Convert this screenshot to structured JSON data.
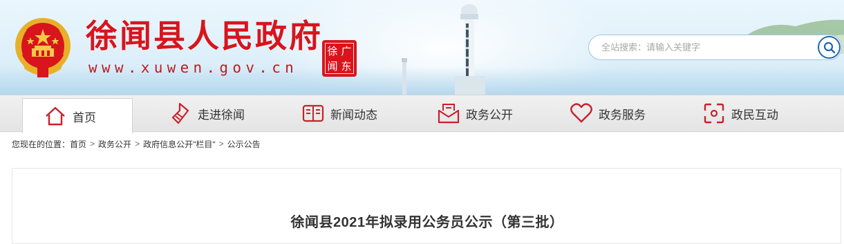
{
  "header": {
    "site_title": "徐闻县人民政府",
    "site_url": "www.xuwen.gov.cn",
    "seal_chars": [
      "徐",
      "广",
      "闻",
      "东"
    ]
  },
  "search": {
    "placeholder": "全站搜索：请输入关键字",
    "button_icon": "search-icon"
  },
  "nav": {
    "items": [
      {
        "label": "首页",
        "icon": "home-icon",
        "active": true
      },
      {
        "label": "走进徐闻",
        "icon": "lightning-tag-icon",
        "active": false
      },
      {
        "label": "新闻动态",
        "icon": "book-icon",
        "active": false
      },
      {
        "label": "政务公开",
        "icon": "mail-document-icon",
        "active": false
      },
      {
        "label": "政务服务",
        "icon": "heart-icon",
        "active": false
      },
      {
        "label": "政民互动",
        "icon": "interaction-icon",
        "active": false
      }
    ]
  },
  "breadcrumb": {
    "prefix": "您现在的位置：",
    "items": [
      "首页",
      "政务公开",
      "政府信息公开\"栏目\"",
      "公示公告"
    ],
    "separator": ">"
  },
  "article": {
    "title": "徐闻县2021年拟录用公务员公示（第三批）"
  },
  "colors": {
    "brand_red": "#d8141c",
    "nav_icon_red": "#c8202a",
    "search_blue": "#1f66b1"
  }
}
